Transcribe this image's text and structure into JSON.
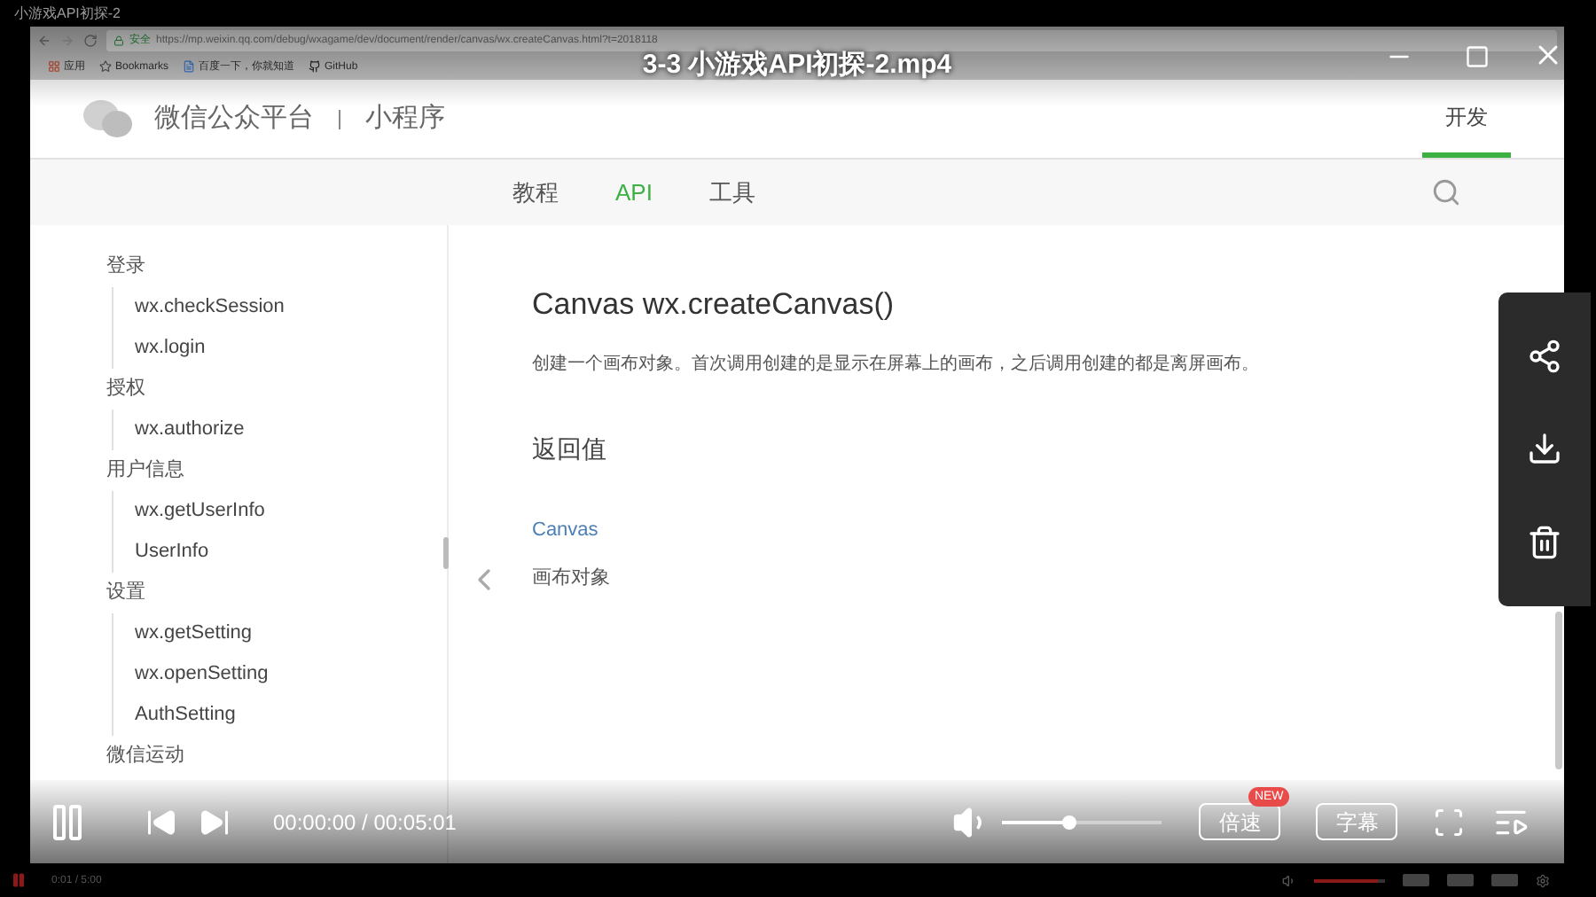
{
  "player": {
    "window_title": "小游戏API初探-2",
    "video_title": "3-3 小游戏API初探-2.mp4"
  },
  "browser": {
    "security": "安全",
    "url": "https://mp.weixin.qq.com/debug/wxagame/dev/document/render/canvas/wx.createCanvas.html?t=2018118",
    "bookmarks": [
      {
        "label": "应用",
        "kind": "apps"
      },
      {
        "label": "Bookmarks",
        "kind": "star"
      },
      {
        "label": "百度一下，你就知道",
        "kind": "page"
      },
      {
        "label": "GitHub",
        "kind": "github"
      }
    ]
  },
  "site": {
    "brand": "微信公众平台",
    "section": "小程序",
    "top_nav": [
      {
        "label": "开发",
        "selected": true
      }
    ],
    "tabs": [
      {
        "label": "教程",
        "selected": false
      },
      {
        "label": "API",
        "selected": true
      },
      {
        "label": "工具",
        "selected": false
      }
    ]
  },
  "sidebar": [
    {
      "label": "登录",
      "children": [
        {
          "label": "wx.checkSession"
        },
        {
          "label": "wx.login"
        }
      ]
    },
    {
      "label": "授权",
      "children": [
        {
          "label": "wx.authorize"
        }
      ]
    },
    {
      "label": "用户信息",
      "children": [
        {
          "label": "wx.getUserInfo"
        },
        {
          "label": "UserInfo"
        }
      ]
    },
    {
      "label": "设置",
      "children": [
        {
          "label": "wx.getSetting"
        },
        {
          "label": "wx.openSetting"
        },
        {
          "label": "AuthSetting"
        }
      ]
    },
    {
      "label": "微信运动"
    }
  ],
  "article": {
    "title": "Canvas wx.createCanvas()",
    "description": "创建一个画布对象。首次调用创建的是显示在屏幕上的画布，之后调用创建的都是离屏画布。",
    "section": "返回值",
    "return_type": "Canvas",
    "return_desc": "画布对象"
  },
  "controls": {
    "playing": true,
    "time": "00:00:00 / 00:05:01",
    "volume": {
      "level": 0.42
    },
    "speed": "倍速",
    "speed_badge": "NEW",
    "subtitles": "字幕"
  },
  "mini_bar": {
    "playing": true,
    "time": "0:01 / 5:00",
    "volume": {
      "level": 0.9
    }
  }
}
